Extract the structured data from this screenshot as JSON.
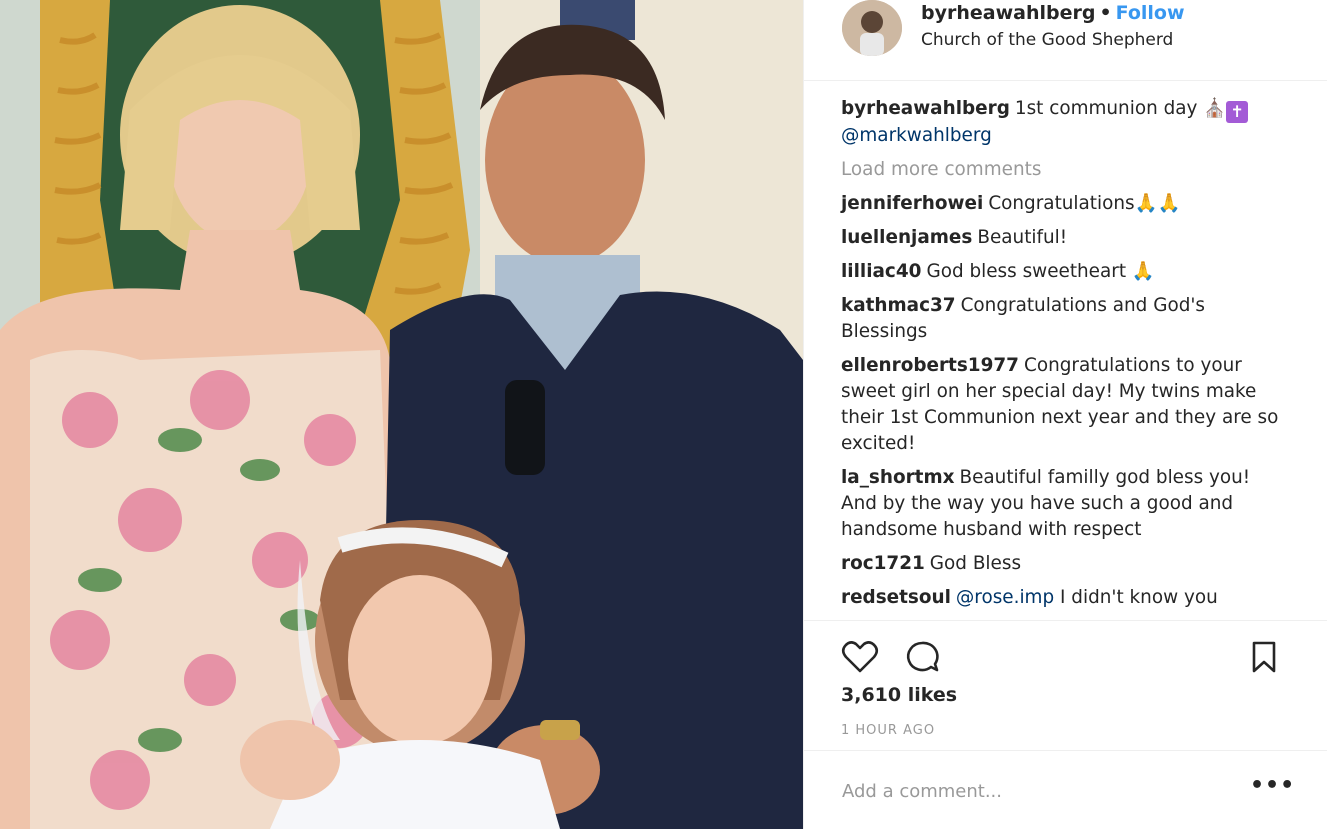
{
  "post": {
    "username": "byrheawahlberg",
    "follow_label": "Follow",
    "separator": "•",
    "location": "Church of the Good Shepherd",
    "caption_text": "1st communion day",
    "caption_mention": "@markwahlberg",
    "load_more": "Load more comments",
    "likes": "3,610 likes",
    "time": "1 HOUR AGO",
    "add_comment_placeholder": "Add a comment...",
    "more_options": "•••"
  },
  "comments": [
    {
      "user": "jenniferhowei",
      "text": "Congratulations",
      "emoji": "🙏🙏"
    },
    {
      "user": "luellenjames",
      "text": "Beautiful!",
      "emoji": ""
    },
    {
      "user": "lilliac40",
      "text": "God bless sweetheart",
      "emoji": "🙏"
    },
    {
      "user": "kathmac37",
      "text": "Congratulations and God's Blessings",
      "emoji": ""
    },
    {
      "user": "ellenroberts1977",
      "text": "Congratulations to your sweet girl on her special day! My twins make their 1st Communion next year and they are so excited!",
      "emoji": ""
    },
    {
      "user": "la_shortmx",
      "text": "Beautiful familly god bless you! And by the way you have such a good and handsome husband with respect",
      "emoji": ""
    },
    {
      "user": "roc1721",
      "text": "God Bless",
      "emoji": ""
    },
    {
      "user": "redsetsoul",
      "mention": "@rose.imp",
      "text": "I didn't know you",
      "emoji": ""
    }
  ],
  "icons": [
    "heart-icon",
    "comment-icon",
    "bookmark-icon",
    "church-icon",
    "cross-icon"
  ],
  "colors": {
    "follow": "#3897f0",
    "mention": "#003569",
    "muted": "#999999",
    "text": "#262626"
  }
}
